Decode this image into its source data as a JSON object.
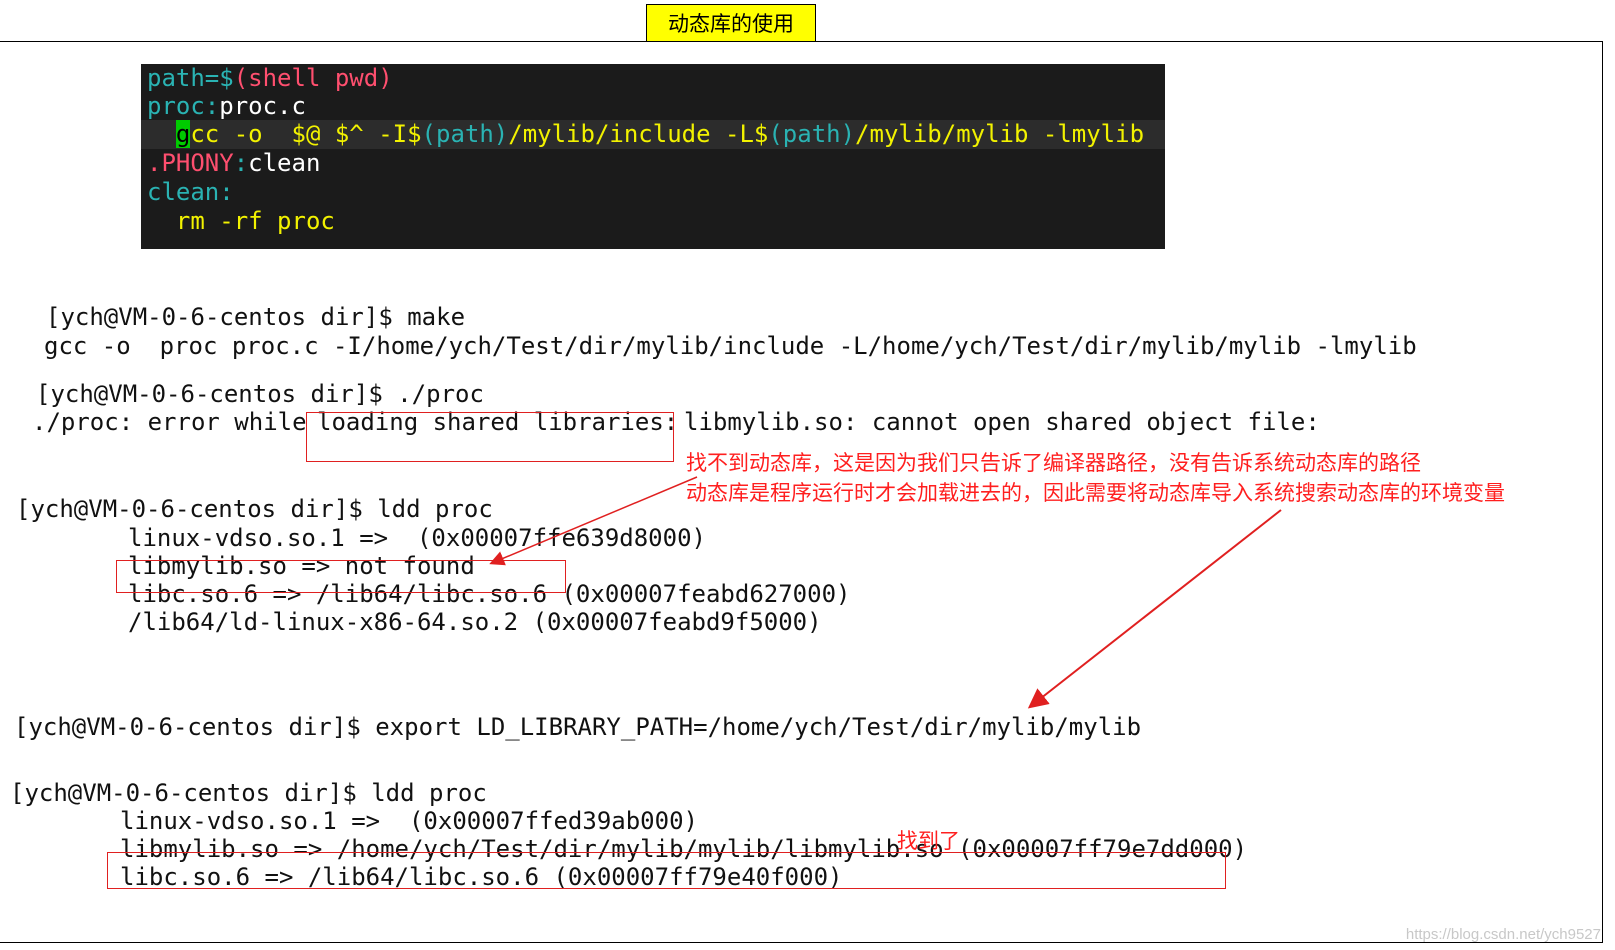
{
  "title": "动态库的使用",
  "makefile": {
    "l1_a": "path=$",
    "l1_b": "(shell pwd)",
    "l2_a": "proc:",
    "l2_b": "proc.c",
    "l3_cursor": "g",
    "l3_a": "cc -o  $@ $^ -I$",
    "l3_b": "(path)",
    "l3_c": "/mylib/include -L$",
    "l3_d": "(path)",
    "l3_e": "/mylib/mylib -lmylib",
    "l4_a": ".PHONY",
    "l4_b": ":",
    "l4_c": "clean",
    "l5": "clean:",
    "l6": "  rm -rf proc"
  },
  "terminal": {
    "make_prompt": "[ych@VM-0-6-centos dir]$ make",
    "make_out": "gcc -o  proc proc.c -I/home/ych/Test/dir/mylib/include -L/home/ych/Test/dir/mylib/mylib -lmylib",
    "run_prompt": "[ych@VM-0-6-centos dir]$ ./proc",
    "run_err_a": "./proc: error while ",
    "run_err_b": "loading shared libraries:",
    "run_err_c": "libmylib.so: cannot open shared object file:",
    "ldd1_prompt": "[ych@VM-0-6-centos dir]$ ldd proc",
    "ldd1_l1": "linux-vdso.so.1 =>  (0x00007ffe639d8000)",
    "ldd1_l2": "libmylib.so => not found",
    "ldd1_l3": "libc.so.6 => /lib64/libc.so.6 (0x00007feabd627000)",
    "ldd1_l4": "/lib64/ld-linux-x86-64.so.2 (0x00007feabd9f5000)",
    "export": "[ych@VM-0-6-centos dir]$ export LD_LIBRARY_PATH=/home/ych/Test/dir/mylib/mylib",
    "ldd2_prompt": "[ych@VM-0-6-centos dir]$ ldd proc",
    "ldd2_l1": "linux-vdso.so.1 =>  (0x00007ffed39ab000)",
    "ldd2_l2": "libmylib.so => /home/ych/Test/dir/mylib/mylib/libmylib.so (0x00007ff79e7dd000)",
    "ldd2_l3": "libc.so.6 => /lib64/libc.so.6 (0x00007ff79e40f000)"
  },
  "annotations": {
    "note1": "找不到动态库，这是因为我们只告诉了编译器路径，没有告诉系统动态库的路径",
    "note2": "动态库是程序运行时才会加载进去的，因此需要将动态库导入系统搜索动态库的环境变量",
    "found": "找到了"
  },
  "watermark": "https://blog.csdn.net/ych9527",
  "colors": {
    "highlight": "#ffff00",
    "annotation": "#ff1f1f",
    "code_bg": "#1b1b1b"
  }
}
